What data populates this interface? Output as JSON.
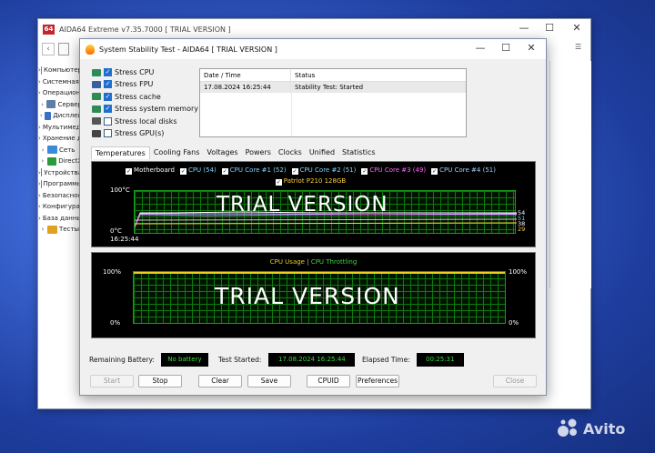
{
  "colors": {
    "accent": "#1f6fd0",
    "graph_green": "#3ddc3d",
    "trial_red": "#c1272d"
  },
  "main_window": {
    "title": "AIDA64 Extreme v7.35.7000  [ TRIAL VERSION ]",
    "minimize": "—",
    "maximize": "☐",
    "close": "✕",
    "tree": [
      {
        "label": "Компьютер",
        "icon": "#4a90d9"
      },
      {
        "label": "Системная плата",
        "icon": "#4b7a3a"
      },
      {
        "label": "Операционная система",
        "icon": "#1f7ad6"
      },
      {
        "label": "Сервер",
        "icon": "#5c7ea8"
      },
      {
        "label": "Дисплей",
        "icon": "#3a6fc4"
      },
      {
        "label": "Мультимедиа",
        "icon": "#5a5a5a"
      },
      {
        "label": "Хранение данных",
        "icon": "#7d7d7d"
      },
      {
        "label": "Сеть",
        "icon": "#3b8bd8"
      },
      {
        "label": "DirectX",
        "icon": "#2a9a3a"
      },
      {
        "label": "Устройства",
        "icon": "#6f6f6f"
      },
      {
        "label": "Программы",
        "icon": "#4a7fd0"
      },
      {
        "label": "Безопасность",
        "icon": "#3b78c8"
      },
      {
        "label": "Конфигурация",
        "icon": "#5b5b5b"
      },
      {
        "label": "База данных",
        "icon": "#3f6fa8"
      },
      {
        "label": "Тесты",
        "icon": "#e0a020"
      }
    ]
  },
  "dialog": {
    "title": "System Stability Test - AIDA64  [ TRIAL VERSION ]",
    "minimize": "—",
    "maximize": "☐",
    "close": "✕",
    "stress": [
      {
        "label": "Stress CPU",
        "checked": true,
        "icon": "cpu-icon"
      },
      {
        "label": "Stress FPU",
        "checked": true,
        "icon": "fpu-icon"
      },
      {
        "label": "Stress cache",
        "checked": true,
        "icon": "cache-icon"
      },
      {
        "label": "Stress system memory",
        "checked": true,
        "icon": "memory-icon"
      },
      {
        "label": "Stress local disks",
        "checked": false,
        "icon": "disk-icon"
      },
      {
        "label": "Stress GPU(s)",
        "checked": false,
        "icon": "gpu-icon"
      }
    ],
    "status_table": {
      "headers": [
        "Date / Time",
        "Status"
      ],
      "rows": [
        [
          "17.08.2024 16:25:44",
          "Stability Test: Started"
        ]
      ]
    },
    "tabs": [
      "Temperatures",
      "Cooling Fans",
      "Voltages",
      "Powers",
      "Clocks",
      "Unified",
      "Statistics"
    ],
    "active_tab": "Temperatures",
    "temp_graph": {
      "legend": [
        {
          "label": "Motherboard",
          "color": "#ffffff"
        },
        {
          "label": "CPU (54)",
          "color": "#7fd3ff"
        },
        {
          "label": "CPU Core #1 (52)",
          "color": "#7fd3ff"
        },
        {
          "label": "CPU Core #2 (51)",
          "color": "#7fd3ff"
        },
        {
          "label": "CPU Core #3 (49)",
          "color": "#ff66ff"
        },
        {
          "label": "CPU Core #4 (51)",
          "color": "#a0d0ff"
        },
        {
          "label": "Patriot P210 128GB",
          "color": "#ffd040"
        }
      ],
      "y_max": "100°C",
      "y_min": "0°C",
      "time": "16:25:44",
      "watermark": "TRIAL VERSION",
      "right_labels": [
        {
          "text": "54",
          "color": "#ffffff"
        },
        {
          "text": "51",
          "color": "#7fd3ff"
        },
        {
          "text": "38",
          "color": "#ffffff"
        },
        {
          "text": "29",
          "color": "#ffd040"
        }
      ]
    },
    "usage_graph": {
      "title_usage": "CPU Usage",
      "sep": "|",
      "title_throttle": "CPU Throttling",
      "left_top": "100%",
      "left_bottom": "0%",
      "right_top": "100%",
      "right_bottom": "0%",
      "watermark": "TRIAL VERSION"
    },
    "info": {
      "battery_label": "Remaining Battery:",
      "battery_value": "No battery",
      "started_label": "Test Started:",
      "started_value": "17.08.2024 16:25:44",
      "elapsed_label": "Elapsed Time:",
      "elapsed_value": "00:25:31"
    },
    "buttons": {
      "start": "Start",
      "stop": "Stop",
      "clear": "Clear",
      "save": "Save",
      "cpuid": "CPUID",
      "preferences": "Preferences",
      "close": "Close"
    }
  },
  "watermark_brand": "Avito"
}
